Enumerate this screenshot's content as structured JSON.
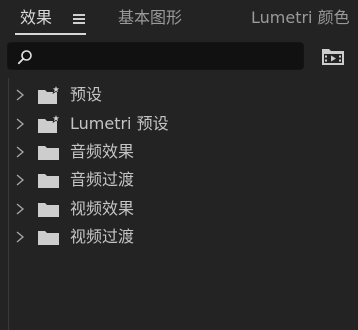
{
  "tabs": [
    {
      "label": "效果",
      "active": true
    },
    {
      "label": "基本图形",
      "active": false
    },
    {
      "label": "Lumetri 颜色",
      "active": false
    }
  ],
  "search": {
    "value": "",
    "placeholder": ""
  },
  "icons": {
    "tab_menu": "hamburger-menu-icon",
    "search": "search-icon",
    "new_bin": "new-custom-bin-icon",
    "expand": "chevron-right-icon",
    "folder": "folder-icon",
    "folder_star": "folder-star-icon"
  },
  "colors": {
    "panel_bg": "#232323",
    "search_bg": "#111111",
    "text_active": "#d8d8d8",
    "text_inactive": "#9a9a9a",
    "item_text": "#c4c4c4",
    "folder": "#cdcdcd"
  },
  "effects_tree": [
    {
      "label": "预设",
      "icon": "folder-star-icon",
      "expanded": false
    },
    {
      "label": "Lumetri 预设",
      "icon": "folder-star-icon",
      "expanded": false
    },
    {
      "label": "音频效果",
      "icon": "folder-icon",
      "expanded": false
    },
    {
      "label": "音频过渡",
      "icon": "folder-icon",
      "expanded": false
    },
    {
      "label": "视频效果",
      "icon": "folder-icon",
      "expanded": false
    },
    {
      "label": "视频过渡",
      "icon": "folder-icon",
      "expanded": false
    }
  ]
}
